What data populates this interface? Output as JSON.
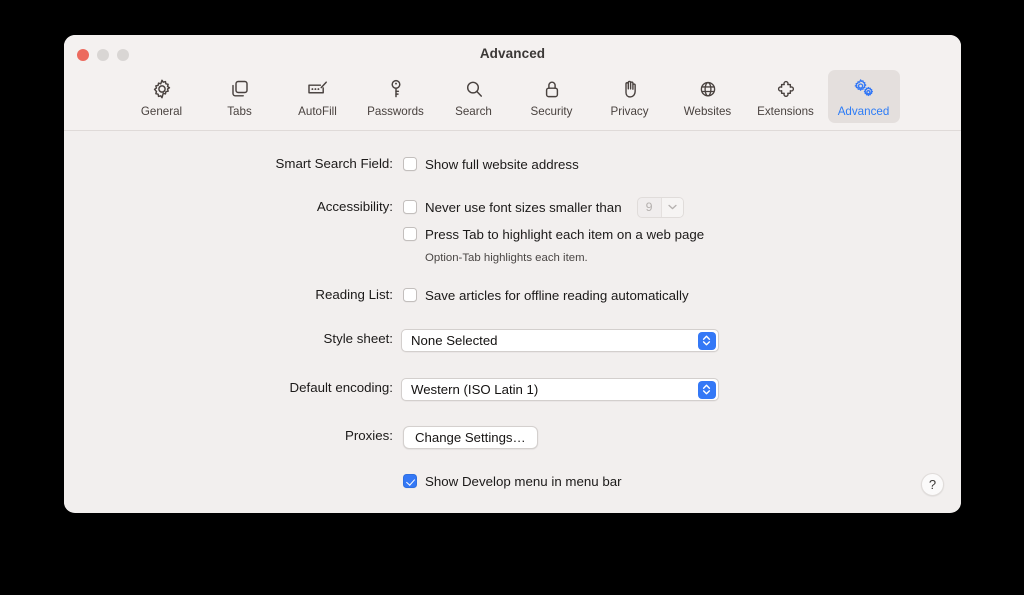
{
  "window": {
    "title": "Advanced",
    "traffic_lights": [
      "close",
      "minimize",
      "zoom"
    ]
  },
  "toolbar": {
    "tabs": [
      {
        "id": "general",
        "label": "General",
        "icon": "gear-icon",
        "selected": false
      },
      {
        "id": "tabs",
        "label": "Tabs",
        "icon": "tabs-icon",
        "selected": false
      },
      {
        "id": "autofill",
        "label": "AutoFill",
        "icon": "autofill-icon",
        "selected": false
      },
      {
        "id": "passwords",
        "label": "Passwords",
        "icon": "key-icon",
        "selected": false
      },
      {
        "id": "search",
        "label": "Search",
        "icon": "magnifier-icon",
        "selected": false
      },
      {
        "id": "security",
        "label": "Security",
        "icon": "padlock-icon",
        "selected": false
      },
      {
        "id": "privacy",
        "label": "Privacy",
        "icon": "hand-icon",
        "selected": false
      },
      {
        "id": "websites",
        "label": "Websites",
        "icon": "globe-icon",
        "selected": false
      },
      {
        "id": "extensions",
        "label": "Extensions",
        "icon": "puzzle-icon",
        "selected": false
      },
      {
        "id": "advanced",
        "label": "Advanced",
        "icon": "double-gear-icon",
        "selected": true
      }
    ]
  },
  "colors": {
    "accent_blue": "#3478f6",
    "selected_tab_label": "#2d7cf6",
    "window_background": "#f2efee",
    "titlebar_background": "#f4f1f0",
    "close_light": "#ec6a5e",
    "inactive_light": "#d9d6d4"
  },
  "settings": {
    "smart_search_field": {
      "label": "Smart Search Field:",
      "checkbox_label": "Show full website address",
      "checked": false
    },
    "accessibility": {
      "label": "Accessibility:",
      "never_use_font_sizes": {
        "checkbox_label": "Never use font sizes smaller than",
        "checked": false,
        "font_size_value": "9",
        "disabled": true
      },
      "press_tab": {
        "checkbox_label": "Press Tab to highlight each item on a web page",
        "checked": false
      },
      "note": "Option-Tab highlights each item."
    },
    "reading_list": {
      "label": "Reading List:",
      "checkbox_label": "Save articles for offline reading automatically",
      "checked": false
    },
    "style_sheet": {
      "label": "Style sheet:",
      "value": "None Selected"
    },
    "default_encoding": {
      "label": "Default encoding:",
      "value": "Western (ISO Latin 1)"
    },
    "proxies": {
      "label": "Proxies:",
      "button_label": "Change Settings…"
    },
    "develop_menu": {
      "checkbox_label": "Show Develop menu in menu bar",
      "checked": true
    }
  },
  "help_button": {
    "label": "?"
  }
}
